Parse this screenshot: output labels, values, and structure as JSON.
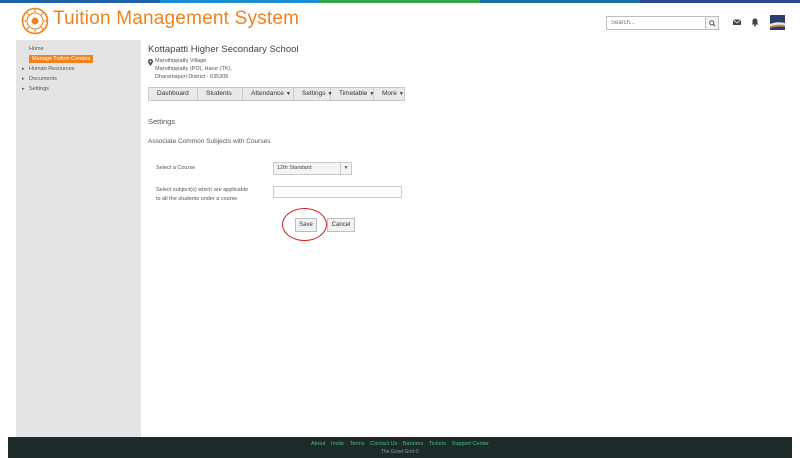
{
  "header": {
    "app_title": "Tuition Management System",
    "search_placeholder": "Search...",
    "stripe_colors": [
      "#1f5fa8",
      "#1f8fd0",
      "#36a84a",
      "#1c6e9e",
      "#2a4a8a"
    ],
    "accent_color": "#f0811f",
    "icons": [
      "search-icon",
      "envelope-icon",
      "bell-icon",
      "avatar"
    ]
  },
  "sidebar": {
    "items": [
      {
        "label": "Home",
        "caret": false
      },
      {
        "label": "Manage Tuition Centers",
        "caret": false,
        "active": true
      },
      {
        "label": "Human Resources",
        "caret": true
      },
      {
        "label": "Documents",
        "caret": true
      },
      {
        "label": "Settings",
        "caret": true
      }
    ]
  },
  "school": {
    "name": "Kottapatti Higher Secondary School",
    "address_line1": "Maruthippatty Village",
    "address_line2": "Maruthippatty (PO), Harur (TK),",
    "address_line3": "Dharamapuri District - 635305"
  },
  "tabs": [
    {
      "label": "Dashboard",
      "dropdown": false
    },
    {
      "label": "Students",
      "dropdown": false
    },
    {
      "label": "Attendance",
      "dropdown": true
    },
    {
      "label": "Settings",
      "dropdown": true
    },
    {
      "label": "Timetable",
      "dropdown": true
    },
    {
      "label": "More",
      "dropdown": true
    }
  ],
  "page": {
    "section_title": "Settings",
    "sub_title": "Associate Common Subjects with Courses",
    "course_label": "Select a Course",
    "course_value": "12th Standard",
    "subjects_label_1": "Select subject(s) which are applicable",
    "subjects_label_2": "to all the students under a course",
    "subjects_value": "",
    "save_label": "Save",
    "cancel_label": "Cancel"
  },
  "footer": {
    "links": [
      "About",
      "Invite",
      "Terms",
      "Contact Us",
      "Banners",
      "Tickets",
      "Support Center"
    ],
    "copyright": "The Good Grid ©"
  }
}
